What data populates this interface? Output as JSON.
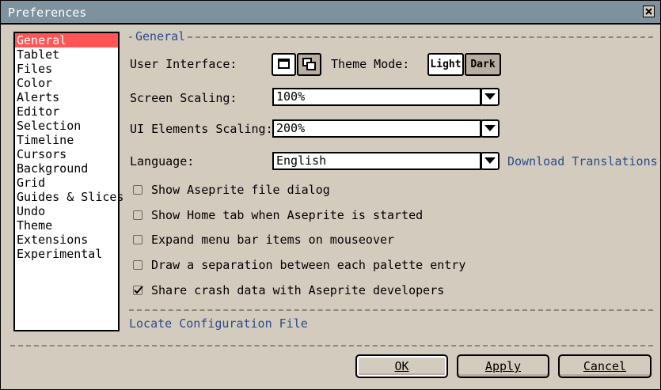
{
  "window": {
    "title": "Preferences"
  },
  "sidebar": {
    "items": [
      {
        "label": "General",
        "selected": true
      },
      {
        "label": "Tablet"
      },
      {
        "label": "Files"
      },
      {
        "label": "Color"
      },
      {
        "label": "Alerts"
      },
      {
        "label": "Editor"
      },
      {
        "label": "Selection"
      },
      {
        "label": "Timeline"
      },
      {
        "label": "Cursors"
      },
      {
        "label": "Background"
      },
      {
        "label": "Grid"
      },
      {
        "label": "Guides & Slices"
      },
      {
        "label": "Undo"
      },
      {
        "label": "Theme"
      },
      {
        "label": "Extensions"
      },
      {
        "label": "Experimental"
      }
    ]
  },
  "general": {
    "section_title": "General",
    "user_interface_label": "User Interface:",
    "ui_modes": [
      {
        "name": "single-window-icon",
        "selected": false
      },
      {
        "name": "multiple-windows-icon",
        "selected": true
      }
    ],
    "theme_mode_label": "Theme Mode:",
    "theme_light": "Light",
    "theme_dark": "Dark",
    "screen_scaling_label": "Screen Scaling:",
    "screen_scaling_value": "100%",
    "ui_elements_scaling_label": "UI Elements Scaling:",
    "ui_elements_scaling_value": "200%",
    "language_label": "Language:",
    "language_value": "English",
    "download_translations": "Download Translations",
    "checkboxes": [
      {
        "label": "Show Aseprite file dialog",
        "checked": false
      },
      {
        "label": "Show Home tab when Aseprite is started",
        "checked": false
      },
      {
        "label": "Expand menu bar items on mouseover",
        "checked": false
      },
      {
        "label": "Draw a separation between each palette entry",
        "checked": false
      },
      {
        "label": "Share crash data with Aseprite developers",
        "checked": true
      }
    ],
    "locate_config": "Locate Configuration File"
  },
  "buttons": {
    "ok": "OK",
    "apply": "Apply",
    "cancel": "Cancel"
  },
  "colors": {
    "titlebar": "#7d929e",
    "window_bg": "#d3cbbe",
    "selection": "#ff5555",
    "link": "#2c4c8c"
  }
}
